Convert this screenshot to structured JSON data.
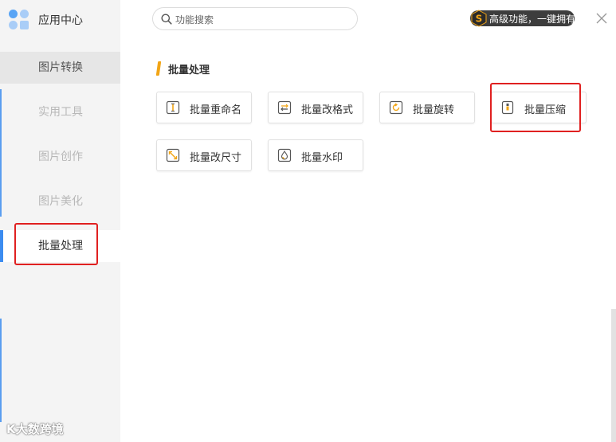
{
  "app": {
    "title": "应用中心",
    "logo_colors": [
      "#5aa5f5",
      "#a9cdf7",
      "#a9cdf7",
      "#a9cdf7"
    ]
  },
  "sidebar": {
    "items": [
      {
        "label": "图片转换",
        "state": "hover"
      },
      {
        "label": "实用工具",
        "state": "normal"
      },
      {
        "label": "图片创作",
        "state": "normal"
      },
      {
        "label": "图片美化",
        "state": "normal"
      },
      {
        "label": "批量处理",
        "state": "active"
      }
    ]
  },
  "search": {
    "placeholder": "功能搜索",
    "value": "",
    "icon": "search-icon"
  },
  "promo": {
    "label": "高级功能，一键拥有",
    "icon": "premium-s-icon",
    "accent": "#f2a516"
  },
  "close": {
    "icon": "close-icon"
  },
  "section": {
    "title": "批量处理",
    "accent": "#f2a516",
    "tools": [
      {
        "label": "批量重命名",
        "icon": "rename-icon"
      },
      {
        "label": "批量改格式",
        "icon": "format-convert-icon"
      },
      {
        "label": "批量旋转",
        "icon": "rotate-icon"
      },
      {
        "label": "批量压缩",
        "icon": "compress-icon"
      },
      {
        "label": "批量改尺寸",
        "icon": "resize-icon"
      },
      {
        "label": "批量水印",
        "icon": "watermark-icon"
      }
    ]
  },
  "colors": {
    "highlight": "#e02020",
    "active_indicator": "#3c8cf0"
  },
  "watermark": "K大数跨境"
}
